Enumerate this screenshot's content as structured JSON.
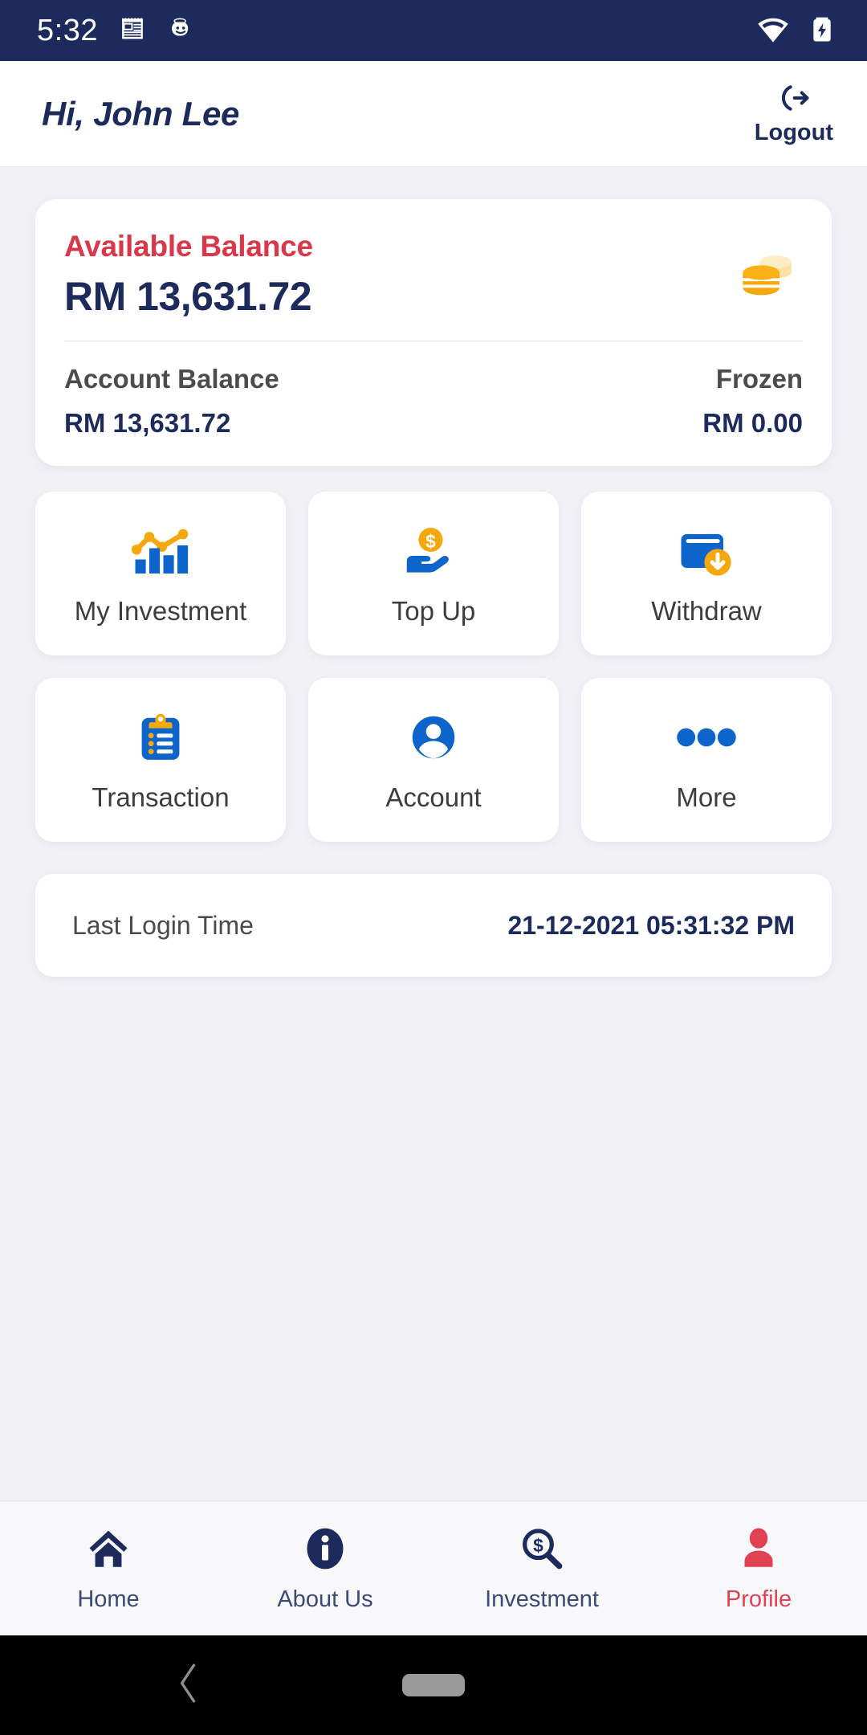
{
  "status_bar": {
    "time": "5:32",
    "notification_icons": [
      "news-notepad-icon",
      "smiley-face-icon"
    ],
    "system_icons": [
      "wifi-icon",
      "battery-charging-icon"
    ],
    "background_color": "#1d2b5c"
  },
  "header": {
    "greeting": "Hi, John Lee",
    "logout_label": "Logout",
    "logout_icon": "sign-out-icon"
  },
  "balance_card": {
    "available_label": "Available Balance",
    "available_amount": "RM 13,631.72",
    "coins_icon": "coin-stack-icon",
    "account_balance_label": "Account Balance",
    "account_balance_value": "RM 13,631.72",
    "frozen_label": "Frozen",
    "frozen_value": "RM 0.00",
    "label_color": "#d9374a",
    "amount_color": "#1d2b5c"
  },
  "actions": [
    {
      "label": "My Investment",
      "icon": "bar-chart-trend-icon"
    },
    {
      "label": "Top Up",
      "icon": "hand-coin-icon"
    },
    {
      "label": "Withdraw",
      "icon": "wallet-download-icon"
    },
    {
      "label": "Transaction",
      "icon": "clipboard-list-icon"
    },
    {
      "label": "Account",
      "icon": "user-circle-icon"
    },
    {
      "label": "More",
      "icon": "three-dots-icon"
    }
  ],
  "last_login": {
    "label": "Last Login Time",
    "value": "21-12-2021 05:31:32 PM"
  },
  "bottom_nav": {
    "items": [
      {
        "label": "Home",
        "icon": "home-icon",
        "active": false
      },
      {
        "label": "About Us",
        "icon": "info-circle-icon",
        "active": false
      },
      {
        "label": "Investment",
        "icon": "search-dollar-icon",
        "active": false
      },
      {
        "label": "Profile",
        "icon": "person-icon",
        "active": true
      }
    ],
    "active_color": "#e04254",
    "inactive_color": "#3c4a72"
  },
  "system_nav": {
    "back_icon": "back-chevron-icon",
    "home_icon": "home-pill-icon"
  },
  "theme": {
    "navy": "#1d2b5c",
    "blue": "#0d64ca",
    "amber": "#f5a80c",
    "red": "#d9374a",
    "page_background": "#f1f1f6",
    "card_background": "#ffffff"
  }
}
